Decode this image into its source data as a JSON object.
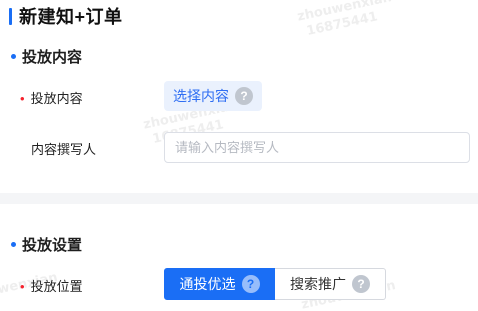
{
  "page": {
    "title": "新建知+订单"
  },
  "sections": {
    "content": {
      "title": "投放内容"
    },
    "settings": {
      "title": "投放设置"
    }
  },
  "fields": {
    "content": {
      "label": "投放内容",
      "required": "•",
      "button_label": "选择内容",
      "help": "?"
    },
    "writer": {
      "label": "内容撰写人",
      "value": "",
      "placeholder": "请输入内容撰写人"
    },
    "placement": {
      "label": "投放位置",
      "required": "•",
      "options": [
        {
          "label": "通投优选",
          "help": "?",
          "selected": true
        },
        {
          "label": "搜索推广",
          "help": "?",
          "selected": false
        }
      ]
    }
  },
  "watermark": {
    "name": "zhouwenxian",
    "id": "16875441"
  },
  "colors": {
    "accent": "#1a6ef5",
    "required": "#f5222d",
    "accent_light": "#eaf1fd"
  }
}
